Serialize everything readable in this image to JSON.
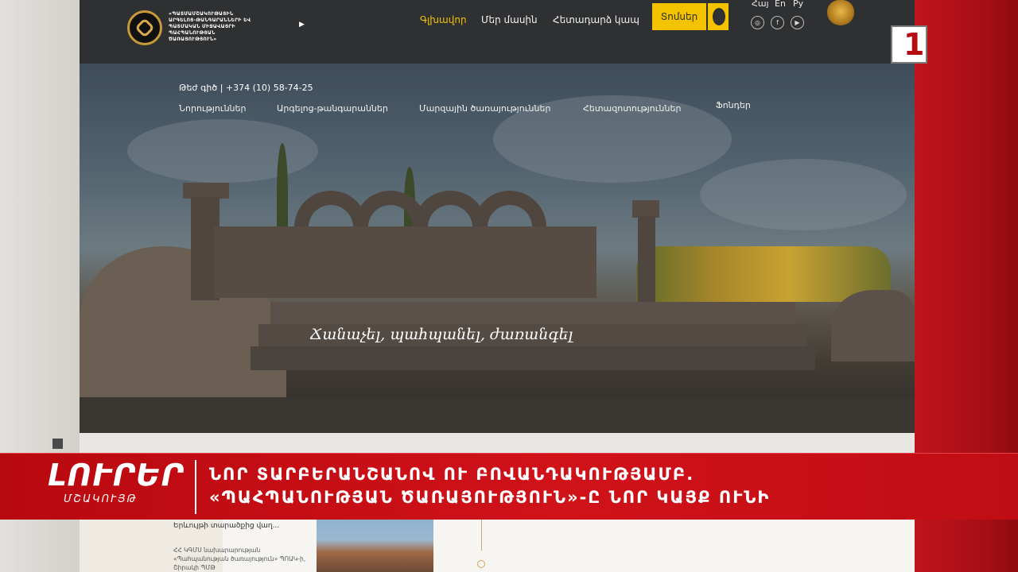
{
  "site": {
    "org_name": "«ՊԱՏՄԱՄՇԱԿՈՒԹԱՅԻՆ ԱՐԳԵԼՈՑ-ԹԱՆԳԱՐԱՆՆԵՐԻ ԵՎ ՊԱՏՄԱԿԱՆ ՄԻՋԱՎԱՅՐԻ ՊԱՀՊԱՆՈՒԹՅԱՆ ԾԱՌԱՅՈՒԹՅՈՒՆ»",
    "nav": [
      "Գլխավոր",
      "Մեր մասին",
      "Հետադարձ կապ"
    ],
    "cta": "Տոմսեր",
    "languages": [
      "Հայ",
      "En",
      "Ру"
    ],
    "social": [
      "instagram-icon",
      "facebook-icon",
      "youtube-icon"
    ],
    "contact": "Թեժ գիծ  |  +374 (10) 58-74-25",
    "menu": [
      "Նորություններ",
      "Արգելոց-թանգարաններ",
      "Մարզային ծառայություններ",
      "Հետազոտություններ",
      "Ֆոնդեր"
    ],
    "slogan": "Ճանաչել, պահպանել, ժառանգել",
    "news_title": "Երևույթի տարածքից վաղ...",
    "news_excerpt": "ՀՀ ԿԳՄՍ նախարարության «Պահպանության ծառայություն» ՊՈԱԿ-ի, Շիրակի ՊՄԹ"
  },
  "broadcast": {
    "channel": "1",
    "program": "ԼՈՒՐԵՐ",
    "program_sub": "ՄՇԱԿՈՒՅԹ",
    "headline_line1": "ՆՈՐ ՏԱՐԲԵՐԱՆՇԱՆՈՎ ՈՒ ԲՈՎԱՆԴԱԿՈՒԹՅԱՄԲ.",
    "headline_line2": "«ՊԱՀՊԱՆՈՒԹՅԱՆ ԾԱՌԱՅՈՒԹՅՈՒՆ»-Ը ՆՈՐ ԿԱՅՔ ՈՒՆԻ"
  },
  "colors": {
    "accent": "#f4c300",
    "header": "#2f3032",
    "ticker": "#c8101a"
  }
}
